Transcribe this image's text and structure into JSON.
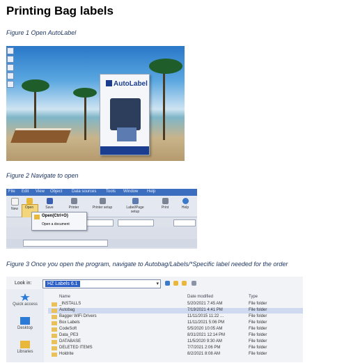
{
  "title": "Printing Bag labels",
  "captions": {
    "fig1": "Figure 1 Open AutoLabel",
    "fig2": "Figure 2 Navigate to open",
    "fig3": "Figure 3 Once you open the program, navigate to Autobag/Labels/*Specific label needed for the order"
  },
  "fig1": {
    "box_logo": "AutoLabel"
  },
  "fig2": {
    "menu": [
      "File",
      "Edit",
      "View",
      "Object",
      "Data sources",
      "Tools",
      "Window",
      "Help"
    ],
    "toolbar": [
      "New",
      "Open",
      "Save",
      "Printer",
      "Printer setup",
      "Label/Page setup",
      "Print",
      "Help"
    ],
    "dropdown": {
      "item": "Open(Ctrl+O)",
      "hint": "Open a document"
    }
  },
  "fig3": {
    "look_in_label": "Look in:",
    "look_in_value": "HZ Labels 6.1",
    "places": [
      "Quick access",
      "Desktop",
      "Libraries"
    ],
    "columns": {
      "name": "Name",
      "date": "Date modified",
      "type": "Type"
    },
    "files": [
      {
        "name": "_INSTALLS",
        "date": "5/20/2021 7:45 AM",
        "type": "File folder"
      },
      {
        "name": "Autobag",
        "date": "7/19/2021 4:41 PM",
        "type": "File folder"
      },
      {
        "name": "Bagger WiFi Drivers",
        "date": "11/11/2015 11:22 ...",
        "type": "File folder"
      },
      {
        "name": "Box Labels",
        "date": "11/11/2021 5:06 PM",
        "type": "File folder"
      },
      {
        "name": "CodeSoft",
        "date": "5/5/2020 10:05 AM",
        "type": "File folder"
      },
      {
        "name": "Data_PE3",
        "date": "8/31/2021 12:14 PM",
        "type": "File folder"
      },
      {
        "name": "DATABASE",
        "date": "11/5/2020 9:30 AM",
        "type": "File folder"
      },
      {
        "name": "DELETED ITEMS",
        "date": "7/7/2021 2:06 PM",
        "type": "File folder"
      },
      {
        "name": "Holdrite",
        "date": "8/2/2021 8:08 AM",
        "type": "File folder"
      }
    ]
  }
}
